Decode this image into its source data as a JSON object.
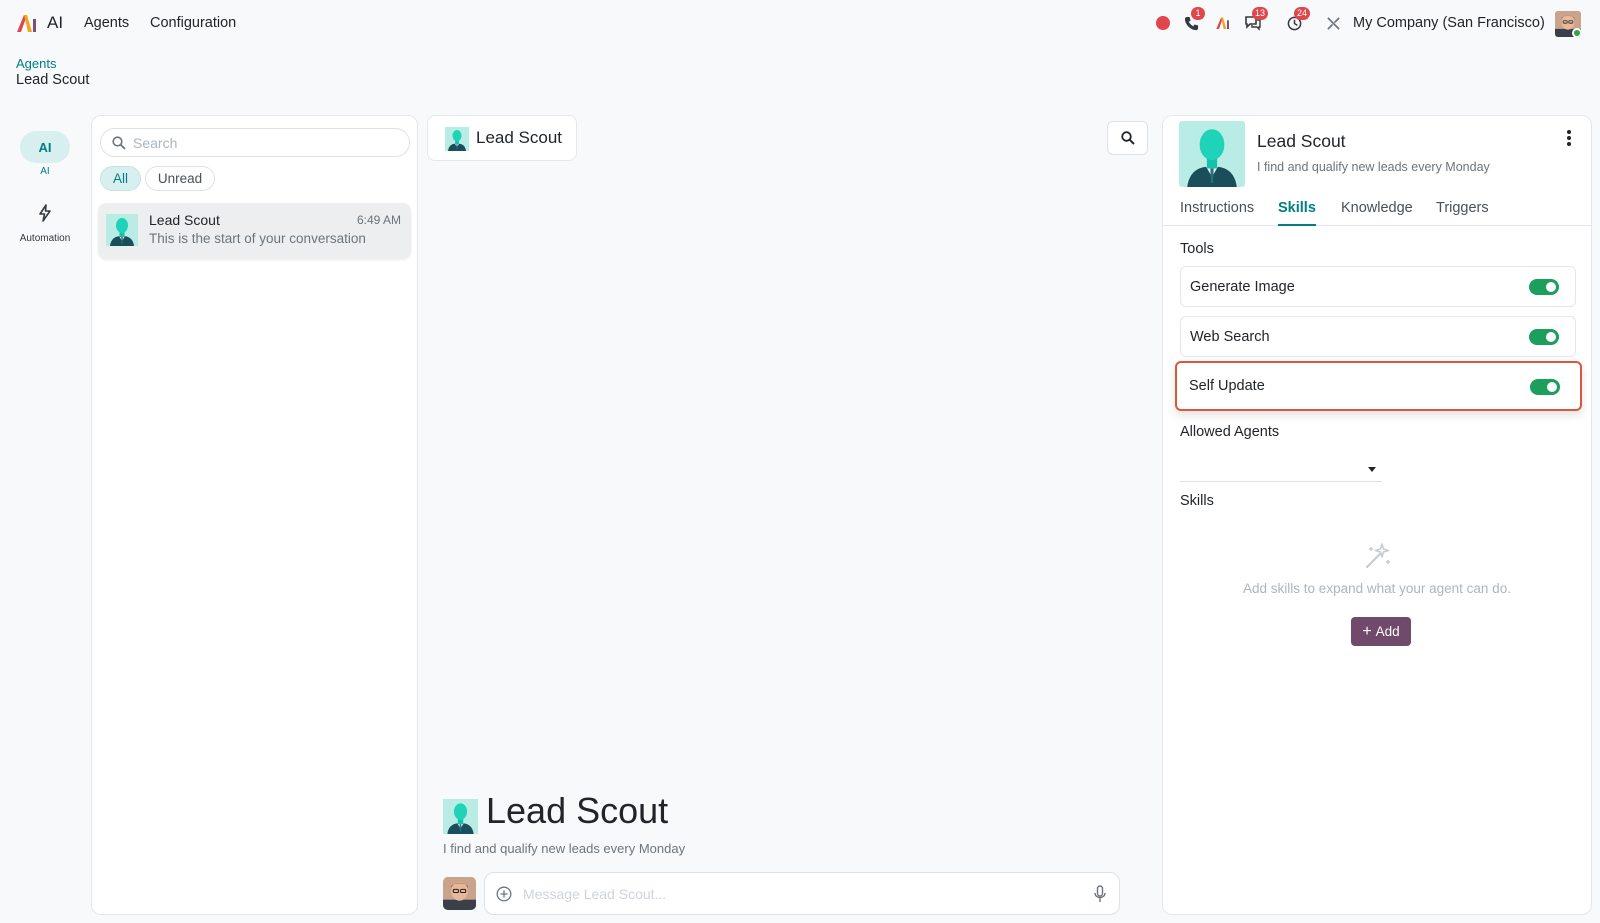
{
  "app": {
    "name": "AI"
  },
  "nav": {
    "agents": "Agents",
    "configuration": "Configuration"
  },
  "systray": {
    "calls_badge": "1",
    "messages_badge": "13",
    "activities_badge": "24",
    "company": "My Company (San Francisco)"
  },
  "breadcrumb": {
    "parent": "Agents",
    "current": "Lead Scout"
  },
  "rail": {
    "ai_icon": "AI",
    "ai_label": "AI",
    "automation_label": "Automation"
  },
  "list": {
    "search_placeholder": "Search",
    "filters": {
      "all": "All",
      "unread": "Unread"
    },
    "conversations": [
      {
        "title": "Lead Scout",
        "time": "6:49 AM",
        "preview": "This is the start of your conversation"
      }
    ]
  },
  "chat": {
    "header_title": "Lead Scout",
    "intro_title": "Lead Scout",
    "intro_subtitle": "I find and qualify new leads every Monday",
    "composer_placeholder": "Message Lead Scout..."
  },
  "agent": {
    "name": "Lead Scout",
    "description": "I find and qualify new leads every Monday",
    "tabs": [
      "Instructions",
      "Skills",
      "Knowledge",
      "Triggers"
    ],
    "active_tab": "Skills",
    "tools_label": "Tools",
    "tools": [
      {
        "label": "Generate Image",
        "enabled": true
      },
      {
        "label": "Web Search",
        "enabled": true
      },
      {
        "label": "Self Update",
        "enabled": true
      }
    ],
    "allowed_agents_label": "Allowed Agents",
    "skills_label": "Skills",
    "skills_empty": "Add skills to expand what your agent can do.",
    "add_button": "Add"
  },
  "colors": {
    "accent": "#017e84",
    "primary_button": "#71496b",
    "toggle_on": "#1e9e5d",
    "highlight_border": "#d9583b",
    "badge": "#e0464a"
  }
}
